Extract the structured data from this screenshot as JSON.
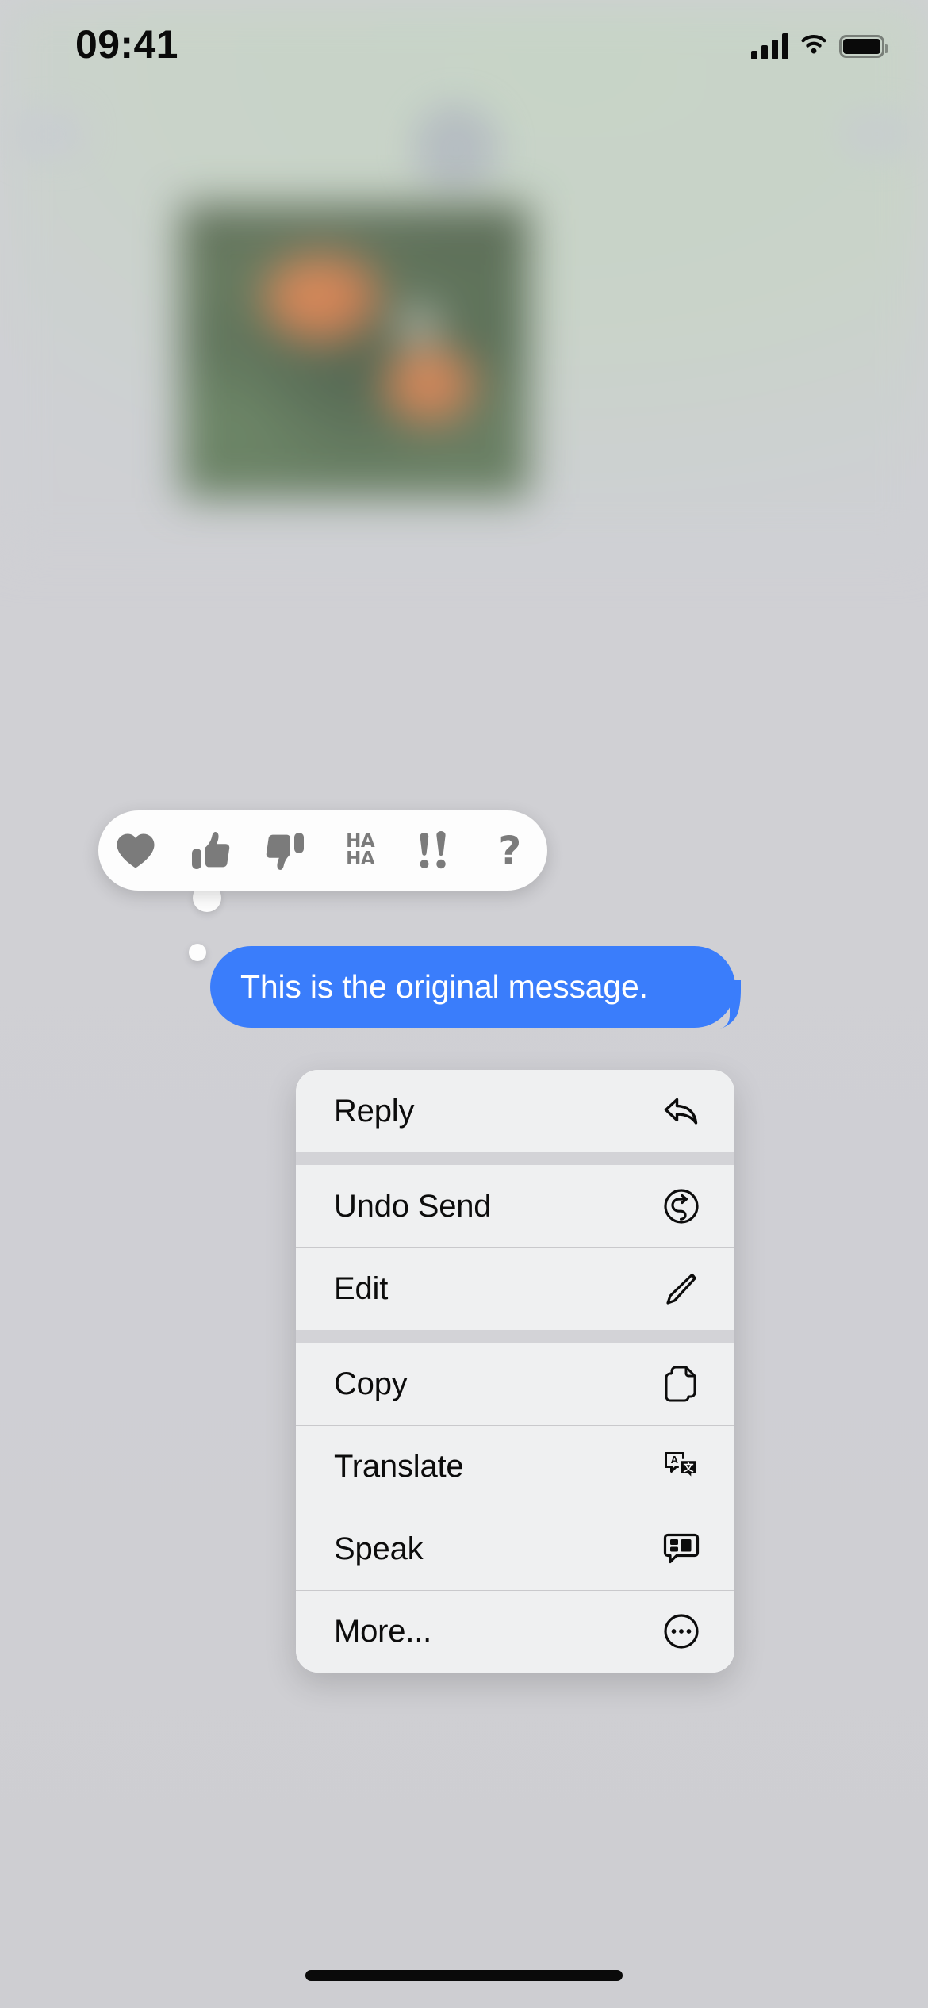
{
  "status_bar": {
    "time": "09:41",
    "cellular_icon": "cellular-bars-icon",
    "wifi_icon": "wifi-icon",
    "battery_icon": "battery-full-icon"
  },
  "conversation": {
    "attachment": {
      "name": "photo-attachment",
      "description": "blurred photo of green foliage with orange flowers"
    },
    "message": {
      "text": "This is the original message.",
      "sender": "outgoing",
      "bubble_color": "#3a7dfb",
      "text_color": "#ffffff"
    }
  },
  "tapback_bar": {
    "background": "#fdfdfd",
    "icon_color": "#7b7b7b",
    "reactions": [
      {
        "id": "heart",
        "label": "Love",
        "glyph": "heart-icon"
      },
      {
        "id": "thumbsup",
        "label": "Like",
        "glyph": "thumbs-up-icon"
      },
      {
        "id": "thumbsdown",
        "label": "Dislike",
        "glyph": "thumbs-down-icon"
      },
      {
        "id": "haha",
        "label": "Haha",
        "glyph": "haha-icon",
        "line1": "HA",
        "line2": "HA"
      },
      {
        "id": "exclamation",
        "label": "Emphasize",
        "glyph": "double-exclamation-icon"
      },
      {
        "id": "question",
        "label": "Question",
        "glyph": "question-mark-icon",
        "text": "?"
      }
    ]
  },
  "context_menu": {
    "background": "#eff0f1",
    "text_color": "#0c0c0c",
    "groups": [
      {
        "items": [
          {
            "label": "Reply",
            "icon": "reply-arrow-icon"
          }
        ]
      },
      {
        "items": [
          {
            "label": "Undo Send",
            "icon": "undo-circle-arrow-icon"
          },
          {
            "label": "Edit",
            "icon": "pencil-icon"
          }
        ]
      },
      {
        "items": [
          {
            "label": "Copy",
            "icon": "copy-documents-icon"
          },
          {
            "label": "Translate",
            "icon": "translate-bubbles-icon"
          },
          {
            "label": "Speak",
            "icon": "speak-bubble-icon"
          },
          {
            "label": "More...",
            "icon": "more-ellipsis-circle-icon"
          }
        ]
      }
    ]
  },
  "home_indicator": {
    "name": "home-indicator"
  }
}
